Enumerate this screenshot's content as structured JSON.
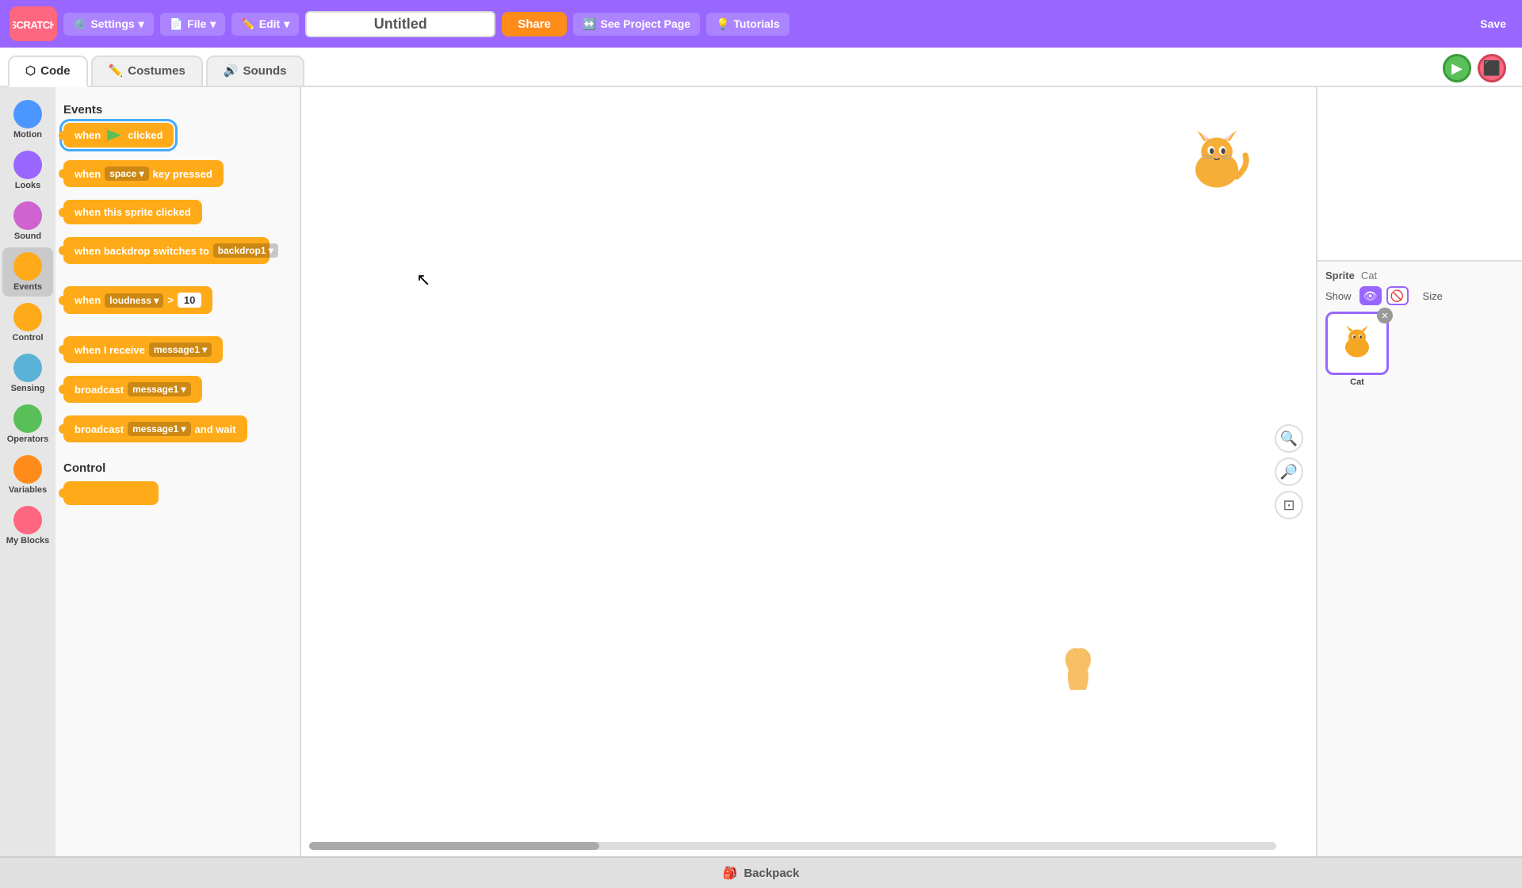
{
  "topbar": {
    "logo_text": "SCRATCH",
    "settings_label": "Settings",
    "file_label": "File",
    "edit_label": "Edit",
    "project_name": "Untitled",
    "share_label": "Share",
    "see_project_label": "See Project Page",
    "tutorials_label": "Tutorials",
    "save_label": "Save"
  },
  "tabs": [
    {
      "id": "code",
      "label": "Code",
      "active": true
    },
    {
      "id": "costumes",
      "label": "Costumes",
      "active": false
    },
    {
      "id": "sounds",
      "label": "Sounds",
      "active": false
    }
  ],
  "sidebar": {
    "categories": [
      {
        "id": "motion",
        "label": "Motion",
        "color": "#4c97ff"
      },
      {
        "id": "looks",
        "label": "Looks",
        "color": "#9966ff"
      },
      {
        "id": "sound",
        "label": "Sound",
        "color": "#cf63cf"
      },
      {
        "id": "events",
        "label": "Events",
        "color": "#ffab19",
        "active": true
      },
      {
        "id": "control",
        "label": "Control",
        "color": "#ffab19"
      },
      {
        "id": "sensing",
        "label": "Sensing",
        "color": "#5cb1d6"
      },
      {
        "id": "operators",
        "label": "Operators",
        "color": "#59c059"
      },
      {
        "id": "variables",
        "label": "Variables",
        "color": "#ff8c1a"
      },
      {
        "id": "myblocks",
        "label": "My Blocks",
        "color": "#ff6680"
      }
    ]
  },
  "blocks_panel": {
    "events_header": "Events",
    "blocks": [
      {
        "id": "when-flag-clicked",
        "text": "when",
        "suffix": "clicked",
        "has_flag": true,
        "selected": true
      },
      {
        "id": "when-key-pressed",
        "text": "when",
        "dropdown": "space",
        "suffix": "key pressed"
      },
      {
        "id": "when-sprite-clicked",
        "text": "when this sprite clicked"
      },
      {
        "id": "when-backdrop-switches",
        "text": "when backdrop switches to",
        "dropdown": "backdrop1"
      },
      {
        "id": "when-loudness",
        "text": "when",
        "dropdown": "loudness",
        "operator": ">",
        "input": "10"
      },
      {
        "id": "when-receive",
        "text": "when I receive",
        "dropdown": "message1"
      },
      {
        "id": "broadcast",
        "text": "broadcast",
        "dropdown": "message1"
      },
      {
        "id": "broadcast-wait",
        "text": "broadcast",
        "dropdown": "message1",
        "suffix": "and wait"
      }
    ],
    "control_header": "Control"
  },
  "canvas": {
    "zoom_in_label": "+",
    "zoom_out_label": "−",
    "fit_label": "⊡"
  },
  "stage": {
    "sprite_label": "Sprite",
    "sprite_name": "Cat",
    "show_label": "Show",
    "size_label": "Size"
  },
  "backpack": {
    "label": "Backpack"
  }
}
